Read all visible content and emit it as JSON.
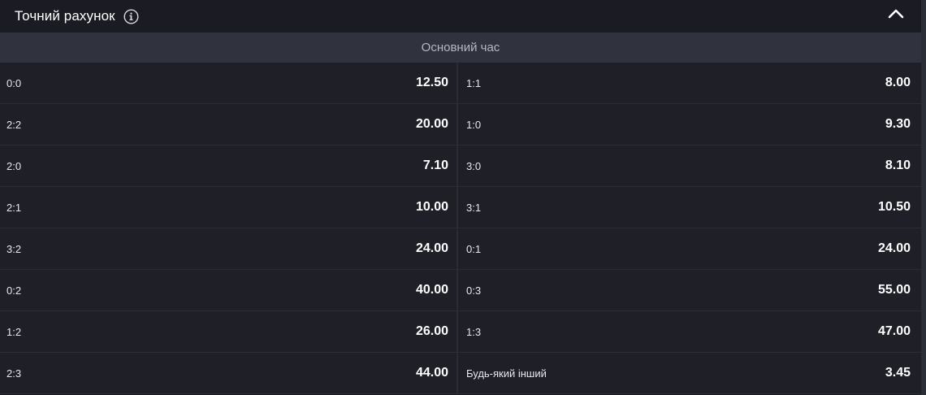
{
  "market": {
    "title": "Точний рахунок",
    "period_label": "Основний час"
  },
  "colors": {
    "background": "#1b1c23",
    "row_background": "#1e1f27",
    "subheader_background": "#30323d",
    "divider": "#2a2c36",
    "text": "#ffffff",
    "muted_text": "#b7b8c0"
  },
  "icons": {
    "info": "info-icon",
    "collapse": "chevron-up-icon"
  },
  "rows": [
    {
      "left": {
        "label": "0:0",
        "odds": "12.50"
      },
      "right": {
        "label": "1:1",
        "odds": "8.00"
      }
    },
    {
      "left": {
        "label": "2:2",
        "odds": "20.00"
      },
      "right": {
        "label": "1:0",
        "odds": "9.30"
      }
    },
    {
      "left": {
        "label": "2:0",
        "odds": "7.10"
      },
      "right": {
        "label": "3:0",
        "odds": "8.10"
      }
    },
    {
      "left": {
        "label": "2:1",
        "odds": "10.00"
      },
      "right": {
        "label": "3:1",
        "odds": "10.50"
      }
    },
    {
      "left": {
        "label": "3:2",
        "odds": "24.00"
      },
      "right": {
        "label": "0:1",
        "odds": "24.00"
      }
    },
    {
      "left": {
        "label": "0:2",
        "odds": "40.00"
      },
      "right": {
        "label": "0:3",
        "odds": "55.00"
      }
    },
    {
      "left": {
        "label": "1:2",
        "odds": "26.00"
      },
      "right": {
        "label": "1:3",
        "odds": "47.00"
      }
    },
    {
      "left": {
        "label": "2:3",
        "odds": "44.00"
      },
      "right": {
        "label": "Будь-який інший",
        "odds": "3.45"
      }
    }
  ]
}
